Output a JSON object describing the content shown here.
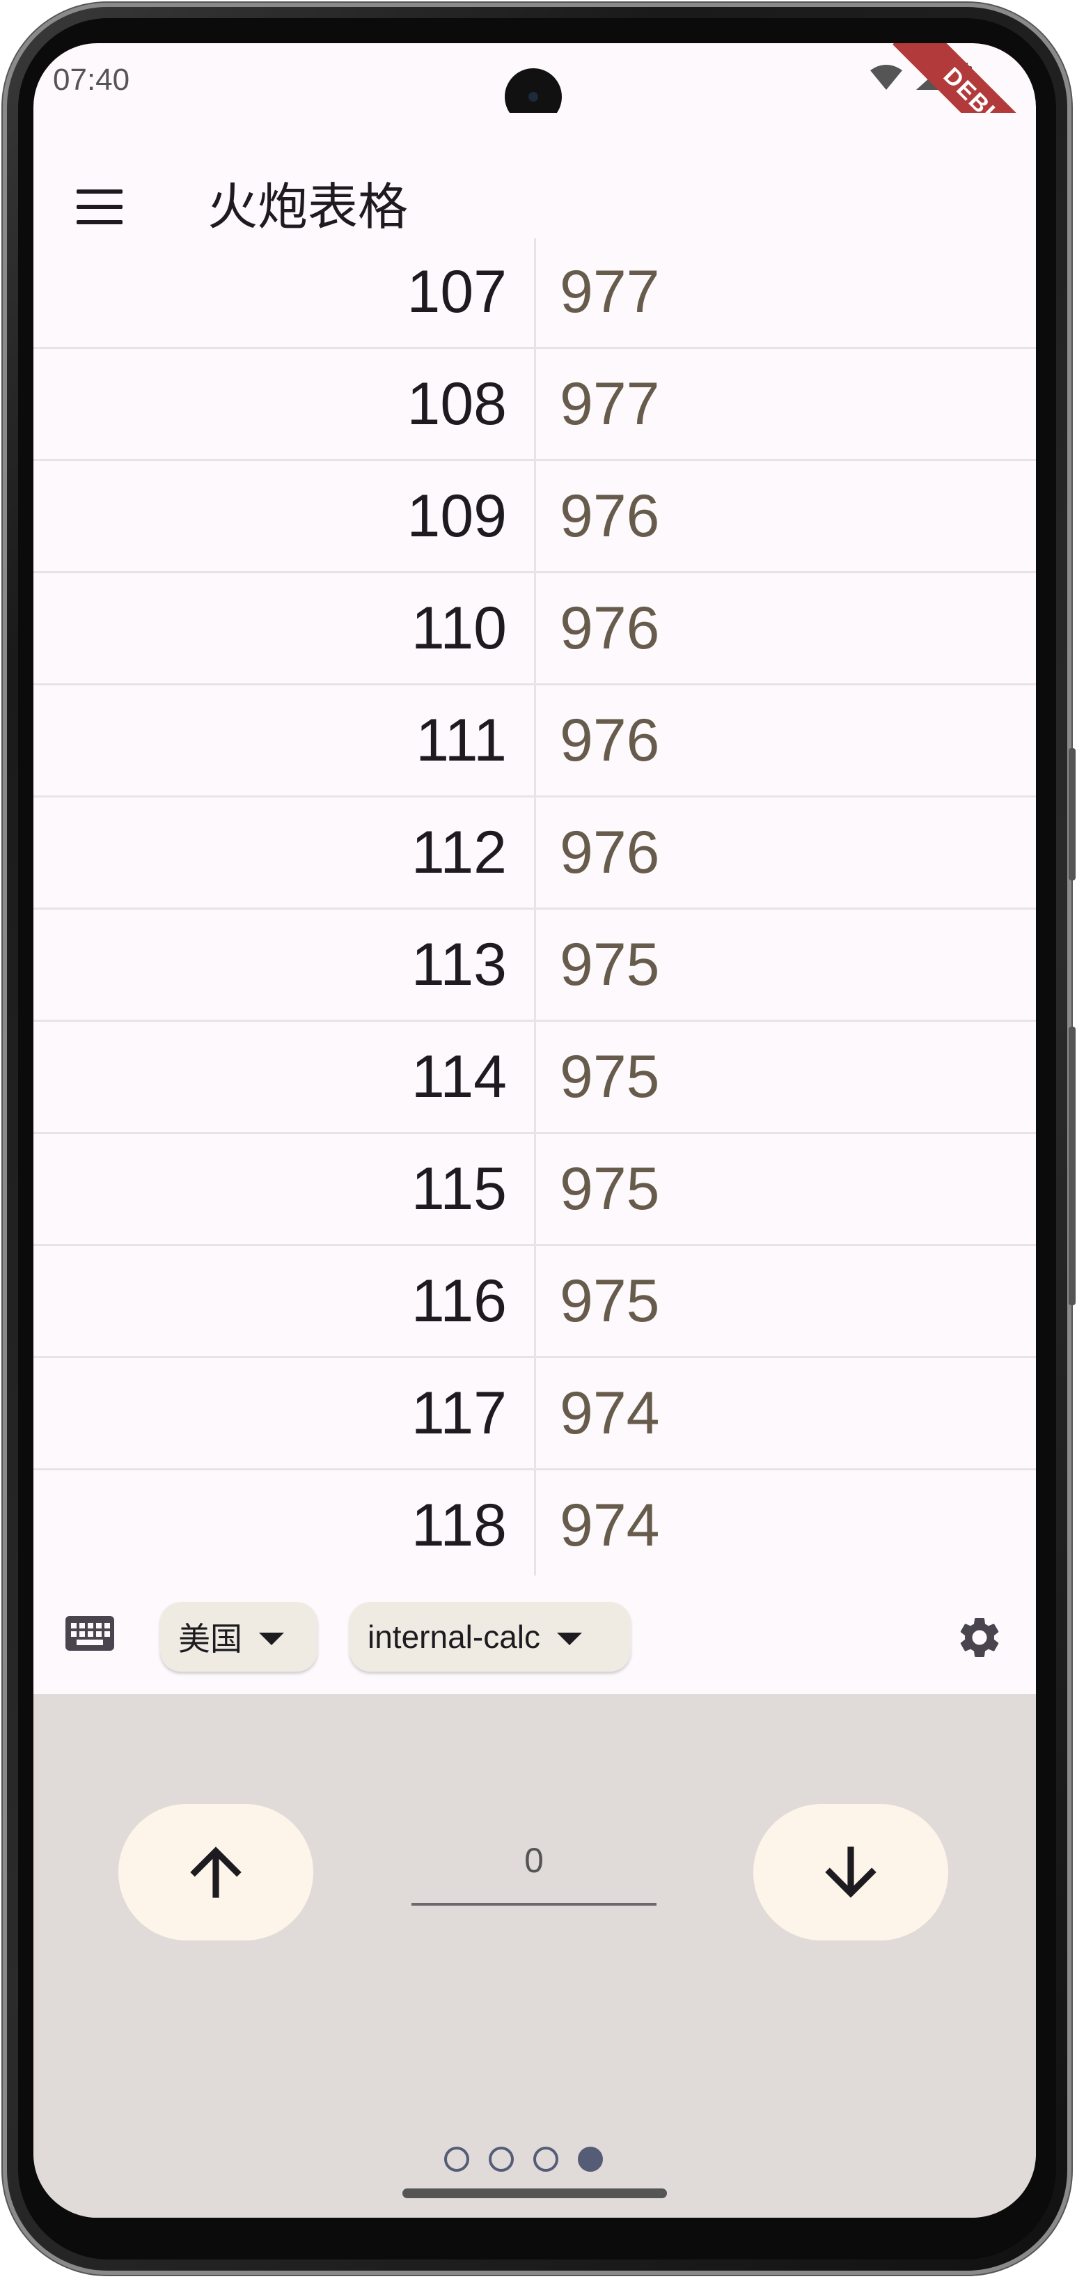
{
  "status_bar": {
    "time": "07:40",
    "debug_label": "DEBUG"
  },
  "app_bar": {
    "title": "火炮表格"
  },
  "table": {
    "rows": [
      {
        "range": "107",
        "mil": "977"
      },
      {
        "range": "108",
        "mil": "977"
      },
      {
        "range": "109",
        "mil": "976"
      },
      {
        "range": "110",
        "mil": "976"
      },
      {
        "range": "111",
        "mil": "976"
      },
      {
        "range": "112",
        "mil": "976"
      },
      {
        "range": "113",
        "mil": "975"
      },
      {
        "range": "114",
        "mil": "975"
      },
      {
        "range": "115",
        "mil": "975"
      },
      {
        "range": "116",
        "mil": "975"
      },
      {
        "range": "117",
        "mil": "974"
      },
      {
        "range": "118",
        "mil": "974"
      }
    ]
  },
  "toolbar": {
    "country_dropdown": "美国",
    "calc_dropdown": "internal-calc"
  },
  "controls": {
    "value": "0",
    "page_indicator": {
      "count": 4,
      "active_index": 3
    }
  },
  "colors": {
    "accent": "#555c76",
    "surface": "#fdf9fc",
    "panel": "#e0dbd8",
    "value_text": "#675c4c"
  }
}
